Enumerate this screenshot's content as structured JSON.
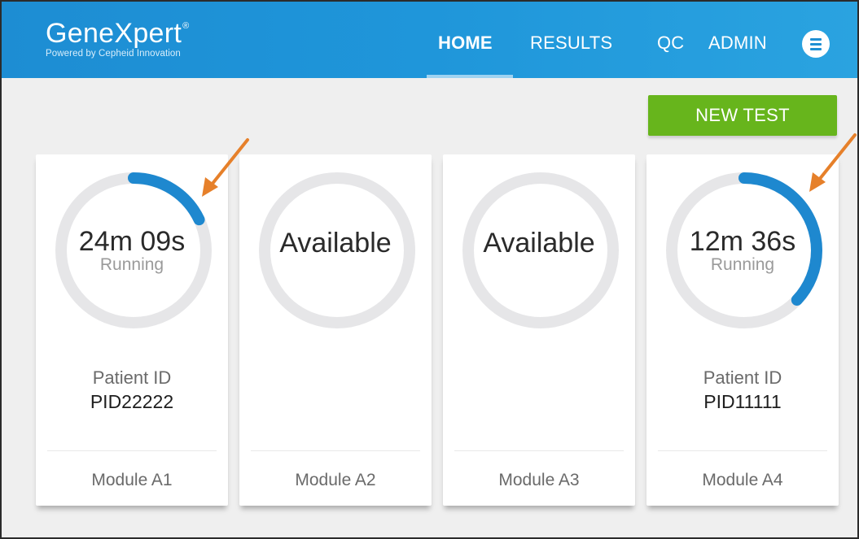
{
  "app": {
    "title": "GeneXpert",
    "trademark": "®",
    "subtitle": "Powered by Cepheid Innovation"
  },
  "nav": {
    "items": [
      {
        "label": "HOME",
        "active": true
      },
      {
        "label": "RESULTS",
        "active": false
      },
      {
        "label": "QC",
        "active": false
      },
      {
        "label": "ADMIN",
        "active": false
      }
    ],
    "menu_icon": "menu-icon"
  },
  "actions": {
    "new_test_label": "NEW TEST"
  },
  "modules": [
    {
      "module_label": "Module A1",
      "status_main": "24m 09s",
      "status_sub": "Running",
      "patient_label": "Patient ID",
      "patient_id": "PID22222",
      "progress": 0.18
    },
    {
      "module_label": "Module A2",
      "status_main": "Available",
      "status_sub": "",
      "patient_label": "",
      "patient_id": "",
      "progress": 0
    },
    {
      "module_label": "Module A3",
      "status_main": "Available",
      "status_sub": "",
      "patient_label": "",
      "patient_id": "",
      "progress": 0
    },
    {
      "module_label": "Module A4",
      "status_main": "12m 36s",
      "status_sub": "Running",
      "patient_label": "Patient ID",
      "patient_id": "PID11111",
      "progress": 0.37
    }
  ],
  "colors": {
    "header_blue": "#1f93d8",
    "progress_blue": "#1e88cf",
    "ring_track": "#e6e6e8",
    "new_test_green": "#67b51c",
    "arrow_orange": "#e6802a"
  }
}
